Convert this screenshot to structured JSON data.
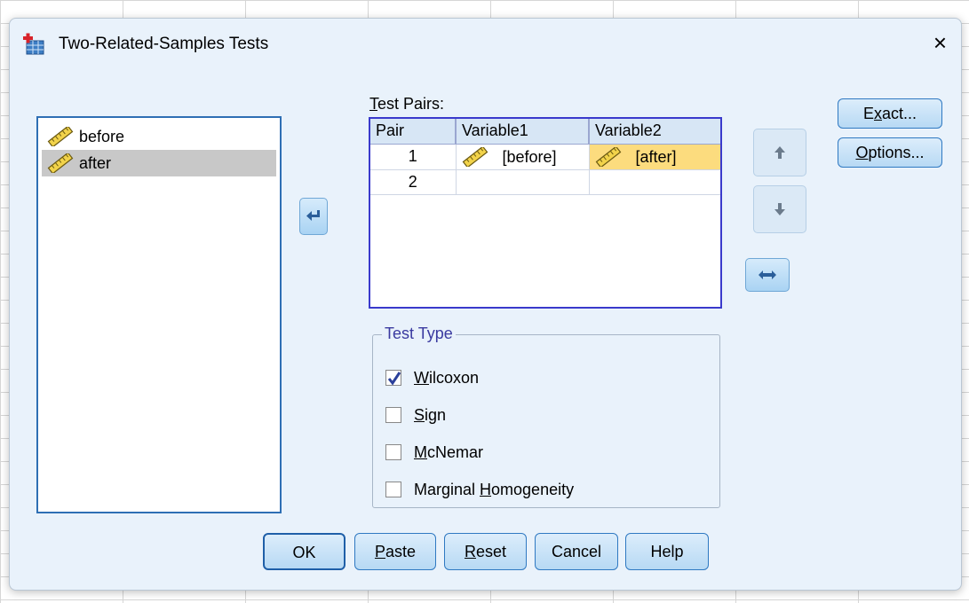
{
  "dialog": {
    "title": "Two-Related-Samples Tests",
    "close_label": "×"
  },
  "variables": [
    {
      "name": "before",
      "icon": "ruler-icon",
      "selected": false
    },
    {
      "name": "after",
      "icon": "ruler-icon",
      "selected": true
    }
  ],
  "test_pairs": {
    "label_prefix": "T",
    "label_rest": "est Pairs:",
    "headers": [
      "Pair",
      "Variable1",
      "Variable2"
    ],
    "rows": [
      {
        "pair": "1",
        "variable1": "[before]",
        "variable2": "[after]"
      },
      {
        "pair": "2",
        "variable1": "",
        "variable2": ""
      }
    ]
  },
  "test_type": {
    "title": "Test Type",
    "options": [
      {
        "pre": "",
        "key": "W",
        "post": "ilcoxon",
        "checked": true
      },
      {
        "pre": "",
        "key": "S",
        "post": "ign",
        "checked": false
      },
      {
        "pre": "",
        "key": "M",
        "post": "cNemar",
        "checked": false
      },
      {
        "pre": "Marginal ",
        "key": "H",
        "post": "omogeneity",
        "checked": false
      }
    ]
  },
  "side_buttons": {
    "exact": {
      "pre": "E",
      "key": "x",
      "post": "act..."
    },
    "options": {
      "pre": "",
      "key": "O",
      "post": "ptions..."
    }
  },
  "bottom_buttons": {
    "ok": "OK",
    "paste": {
      "key": "P",
      "post": "aste"
    },
    "reset": {
      "key": "R",
      "post": "eset"
    },
    "cancel": "Cancel",
    "help": "Help"
  },
  "colors": {
    "accent": "#2e6fb4",
    "selected_cell": "#fcdc7e",
    "dialog_bg": "#e9f2fb"
  }
}
